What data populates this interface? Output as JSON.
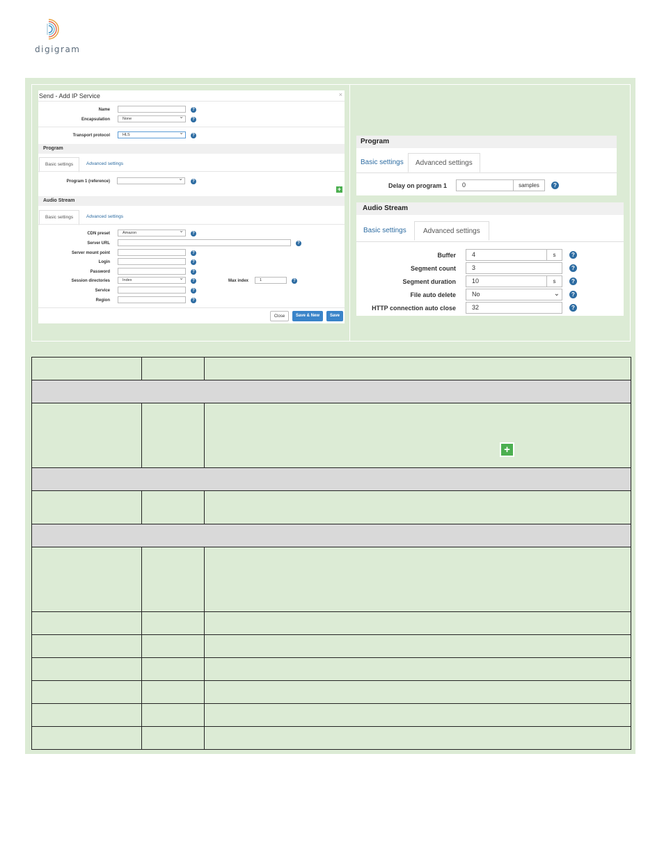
{
  "logo": {
    "text": "digigram",
    "icon": "digigram-arcs-logo"
  },
  "modal": {
    "title": "Send - Add IP Service",
    "close_glyph": "×",
    "fields_top": [
      {
        "label": "Name",
        "value": ""
      },
      {
        "label": "Encapsulation",
        "value": "None"
      },
      {
        "label": "Transport protocol",
        "value": "HLS"
      }
    ],
    "program": {
      "header": "Program",
      "tab_basic": "Basic settings",
      "tab_advanced": "Advanced settings",
      "field_label": "Program 1 (reference)",
      "field_value": ""
    },
    "audio": {
      "header": "Audio Stream",
      "tab_basic": "Basic settings",
      "tab_advanced": "Advanced settings",
      "fields": [
        {
          "label": "CDN preset",
          "value": "Amazon"
        },
        {
          "label": "Server URL",
          "value": ""
        },
        {
          "label": "Server mount point",
          "value": ""
        },
        {
          "label": "Login",
          "value": ""
        },
        {
          "label": "Password",
          "value": ""
        },
        {
          "label": "Session directories",
          "value": "Index"
        },
        {
          "label": "Service",
          "value": ""
        },
        {
          "label": "Region",
          "value": ""
        }
      ],
      "max_index_label": "Max index",
      "max_index_value": "1"
    },
    "buttons": {
      "close": "Close",
      "save_new": "Save & New",
      "save": "Save"
    }
  },
  "right_program": {
    "header": "Program",
    "tab_basic": "Basic settings",
    "tab_advanced": "Advanced settings",
    "delay_label": "Delay on program 1",
    "delay_value": "0",
    "delay_unit": "samples"
  },
  "right_audio": {
    "header": "Audio Stream",
    "tab_basic": "Basic settings",
    "tab_advanced": "Advanced settings",
    "fields": [
      {
        "label": "Buffer",
        "value": "4",
        "unit": "s"
      },
      {
        "label": "Segment count",
        "value": "3",
        "unit": ""
      },
      {
        "label": "Segment duration",
        "value": "10",
        "unit": "s"
      },
      {
        "label": "File auto delete",
        "value": "No",
        "unit": ""
      },
      {
        "label": "HTTP connection auto close",
        "value": "32",
        "unit": ""
      }
    ]
  },
  "help_glyph": "?",
  "plus_glyph": "+",
  "colors": {
    "panel_green": "#dcebd5",
    "link_blue": "#2d6ca2",
    "primary_blue": "#3a84c9",
    "plus_green": "#4caf50"
  }
}
